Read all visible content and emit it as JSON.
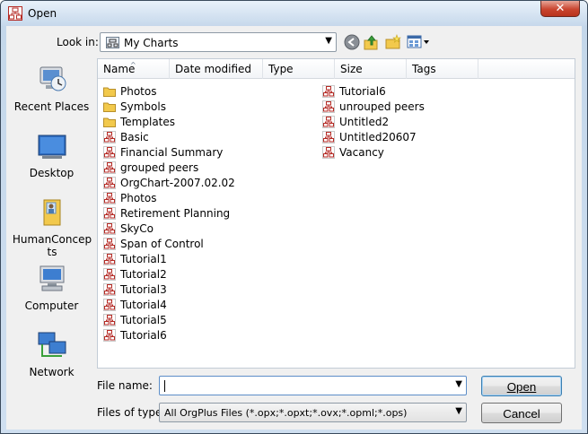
{
  "window": {
    "title": "Open",
    "close_glyph": "✕"
  },
  "lookin": {
    "label": "Look in:",
    "value": "My Charts"
  },
  "places": [
    {
      "label": "Recent Places",
      "icon": "recent-places-icon"
    },
    {
      "label": "Desktop",
      "icon": "desktop-icon"
    },
    {
      "label": "HumanConcepts",
      "icon": "user-folder-icon"
    },
    {
      "label": "Computer",
      "icon": "computer-icon"
    },
    {
      "label": "Network",
      "icon": "network-icon"
    }
  ],
  "columns": [
    "Name",
    "Date modified",
    "Type",
    "Size",
    "Tags"
  ],
  "files_col1": [
    {
      "name": "Photos",
      "kind": "folder"
    },
    {
      "name": "Symbols",
      "kind": "folder"
    },
    {
      "name": "Templates",
      "kind": "folder"
    },
    {
      "name": "Basic",
      "kind": "chart"
    },
    {
      "name": "Financial Summary",
      "kind": "chart"
    },
    {
      "name": "grouped peers",
      "kind": "chart"
    },
    {
      "name": "OrgChart-2007.02.02",
      "kind": "chart"
    },
    {
      "name": "Photos",
      "kind": "chart"
    },
    {
      "name": "Retirement Planning",
      "kind": "chart"
    },
    {
      "name": "SkyCo",
      "kind": "chart"
    },
    {
      "name": "Span of Control",
      "kind": "chart"
    },
    {
      "name": "Tutorial1",
      "kind": "chart"
    },
    {
      "name": "Tutorial2",
      "kind": "chart"
    },
    {
      "name": "Tutorial3",
      "kind": "chart"
    },
    {
      "name": "Tutorial4",
      "kind": "chart"
    },
    {
      "name": "Tutorial5",
      "kind": "chart"
    },
    {
      "name": "Tutorial6",
      "kind": "chart"
    }
  ],
  "files_col2": [
    {
      "name": "Tutorial6",
      "kind": "chart"
    },
    {
      "name": "unrouped peers",
      "kind": "chart"
    },
    {
      "name": "Untitled2",
      "kind": "chart"
    },
    {
      "name": "Untitled20607",
      "kind": "chart"
    },
    {
      "name": "Vacancy",
      "kind": "chart"
    }
  ],
  "filename": {
    "label": "File name:",
    "value": ""
  },
  "filetype": {
    "label": "Files of type:",
    "value": "All OrgPlus Files (*.opx;*.opxt;*.ovx;*.opml;*.ops)"
  },
  "buttons": {
    "open": "Open",
    "cancel": "Cancel"
  },
  "colors": {
    "accent": "#3c7fb1",
    "folder": "#f2c94c",
    "chart_icon": "#b52a24"
  }
}
